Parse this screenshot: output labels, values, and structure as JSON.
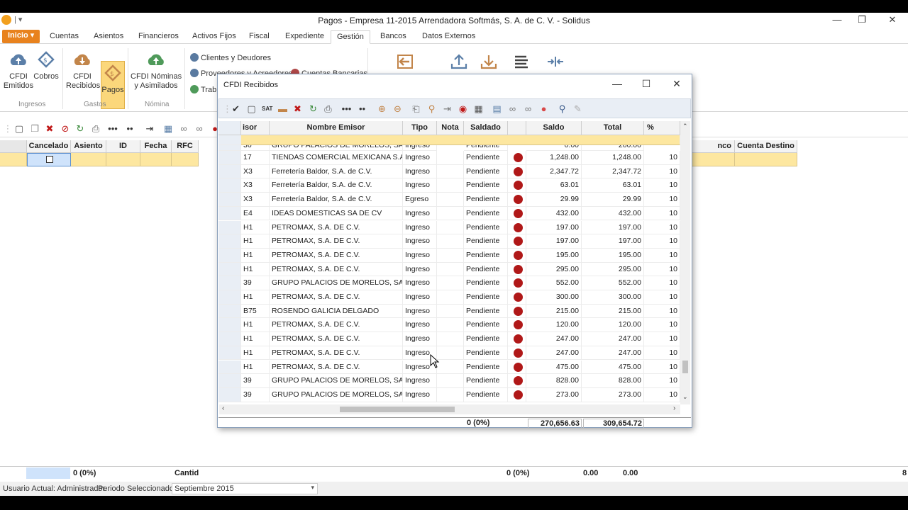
{
  "window": {
    "title": "Pagos - Empresa 11-2015 Arrendadora Softmás, S. A. de C. V. - Solidus",
    "quick_access": "| ▾",
    "minimize": "—",
    "restore": "❐",
    "close": "✕"
  },
  "tabs": [
    {
      "label": "Inicio ▾",
      "active": false,
      "file": true
    },
    {
      "label": "Cuentas",
      "active": false
    },
    {
      "label": "Asientos",
      "active": false
    },
    {
      "label": "Financieros",
      "active": false
    },
    {
      "label": "Activos Fijos",
      "active": false
    },
    {
      "label": "Fiscal",
      "active": false
    },
    {
      "label": "Expediente",
      "active": false
    },
    {
      "label": "Gestión",
      "active": true
    },
    {
      "label": "Bancos",
      "active": false
    },
    {
      "label": "Datos Externos",
      "active": false
    }
  ],
  "ribbon": {
    "cfdi_emitidos": "CFDI\nEmitidos",
    "cobros": "Cobros",
    "cfdi_recibidos": "CFDI\nRecibidos",
    "pagos": "Pagos",
    "cfdi_nominas": "CFDI Nóminas\ny Asimilados",
    "clientes_deudores": "Clientes y Deudores",
    "proveedores_acreedores": "Proveedores y Acreedores",
    "cuentas_bancarias": "Cuentas Bancarias",
    "trabajadores": "Trab",
    "group_ingresos": "Ingresos",
    "group_gastos": "Gastos",
    "group_nomina": "Nómina"
  },
  "main_grid": {
    "headers": [
      "Cancelado",
      "Asiento",
      "ID",
      "Fecha",
      "RFC"
    ],
    "right_headers": [
      "nco Destino",
      "Cuenta Destino"
    ]
  },
  "footer": {
    "count_left": "0 (0%)",
    "cantid": "Cantid",
    "count_mid": "0 (0%)",
    "total1": "0.00",
    "total2": "0.00",
    "edge": "8"
  },
  "statusbar": {
    "user": "Usuario Actual: Administrador",
    "period_label": "Periodo Seleccionado:",
    "period_value": "Septiembre 2015"
  },
  "dialog": {
    "title": "CFDI Recibidos",
    "minimize": "—",
    "maximize": "☐",
    "close": "✕",
    "headers": {
      "emisor": "isor",
      "nombre": "Nombre Emisor",
      "tipo": "Tipo",
      "nota": "Nota",
      "saldado": "Saldado",
      "dot": "",
      "saldo": "Saldo",
      "total": "Total",
      "deduc": "% Deduc"
    },
    "partial_row": {
      "emisor": "36",
      "nombre": "GRUPO PALACIOS DE MORELOS, SA DE",
      "tipo": "Ingreso",
      "saldado": "Pendiente",
      "saldo": "0.00",
      "total": "200.00",
      "deduc": ""
    },
    "rows": [
      {
        "emisor": "17",
        "nombre": "TIENDAS COMERCIAL MEXICANA S.A DE",
        "tipo": "Ingreso",
        "saldado": "Pendiente",
        "saldo": "1,248.00",
        "total": "1,248.00",
        "deduc": "10"
      },
      {
        "emisor": "X3",
        "nombre": "Ferretería Baldor, S.A. de C.V.",
        "tipo": "Ingreso",
        "saldado": "Pendiente",
        "saldo": "2,347.72",
        "total": "2,347.72",
        "deduc": "10"
      },
      {
        "emisor": "X3",
        "nombre": "Ferretería Baldor, S.A. de C.V.",
        "tipo": "Ingreso",
        "saldado": "Pendiente",
        "saldo": "63.01",
        "total": "63.01",
        "deduc": "10"
      },
      {
        "emisor": "X3",
        "nombre": "Ferretería Baldor, S.A. de C.V.",
        "tipo": "Egreso",
        "saldado": "Pendiente",
        "saldo": "29.99",
        "total": "29.99",
        "deduc": "10"
      },
      {
        "emisor": "E4",
        "nombre": "IDEAS DOMESTICAS SA DE CV",
        "tipo": "Ingreso",
        "saldado": "Pendiente",
        "saldo": "432.00",
        "total": "432.00",
        "deduc": "10"
      },
      {
        "emisor": "H1",
        "nombre": "PETROMAX, S.A. DE C.V.",
        "tipo": "Ingreso",
        "saldado": "Pendiente",
        "saldo": "197.00",
        "total": "197.00",
        "deduc": "10"
      },
      {
        "emisor": "H1",
        "nombre": "PETROMAX, S.A. DE C.V.",
        "tipo": "Ingreso",
        "saldado": "Pendiente",
        "saldo": "197.00",
        "total": "197.00",
        "deduc": "10"
      },
      {
        "emisor": "H1",
        "nombre": "PETROMAX, S.A. DE C.V.",
        "tipo": "Ingreso",
        "saldado": "Pendiente",
        "saldo": "195.00",
        "total": "195.00",
        "deduc": "10"
      },
      {
        "emisor": "H1",
        "nombre": "PETROMAX, S.A. DE C.V.",
        "tipo": "Ingreso",
        "saldado": "Pendiente",
        "saldo": "295.00",
        "total": "295.00",
        "deduc": "10"
      },
      {
        "emisor": "39",
        "nombre": "GRUPO PALACIOS DE MORELOS, SA DE",
        "tipo": "Ingreso",
        "saldado": "Pendiente",
        "saldo": "552.00",
        "total": "552.00",
        "deduc": "10"
      },
      {
        "emisor": "H1",
        "nombre": "PETROMAX, S.A. DE C.V.",
        "tipo": "Ingreso",
        "saldado": "Pendiente",
        "saldo": "300.00",
        "total": "300.00",
        "deduc": "10"
      },
      {
        "emisor": "B75",
        "nombre": "ROSENDO GALICIA DELGADO",
        "tipo": "Ingreso",
        "saldado": "Pendiente",
        "saldo": "215.00",
        "total": "215.00",
        "deduc": "10"
      },
      {
        "emisor": "H1",
        "nombre": "PETROMAX, S.A. DE C.V.",
        "tipo": "Ingreso",
        "saldado": "Pendiente",
        "saldo": "120.00",
        "total": "120.00",
        "deduc": "10"
      },
      {
        "emisor": "H1",
        "nombre": "PETROMAX, S.A. DE C.V.",
        "tipo": "Ingreso",
        "saldado": "Pendiente",
        "saldo": "247.00",
        "total": "247.00",
        "deduc": "10"
      },
      {
        "emisor": "H1",
        "nombre": "PETROMAX, S.A. DE C.V.",
        "tipo": "Ingreso",
        "saldado": "Pendiente",
        "saldo": "247.00",
        "total": "247.00",
        "deduc": "10"
      },
      {
        "emisor": "H1",
        "nombre": "PETROMAX, S.A. DE C.V.",
        "tipo": "Ingreso",
        "saldado": "Pendiente",
        "saldo": "475.00",
        "total": "475.00",
        "deduc": "10"
      },
      {
        "emisor": "39",
        "nombre": "GRUPO PALACIOS DE MORELOS, SA DE",
        "tipo": "Ingreso",
        "saldado": "Pendiente",
        "saldo": "828.00",
        "total": "828.00",
        "deduc": "10"
      },
      {
        "emisor": "39",
        "nombre": "GRUPO PALACIOS DE MORELOS, SA DE",
        "tipo": "Ingreso",
        "saldado": "Pendiente",
        "saldo": "273.00",
        "total": "273.00",
        "deduc": "10"
      }
    ],
    "footer": {
      "count": "0 (0%)",
      "saldo_total": "270,656.63",
      "total_total": "309,654.72"
    }
  },
  "colors": {
    "accent_orange": "#e8821e",
    "selected_ribbon": "#fbd77b",
    "highlight_row": "#fde7a0",
    "status_dot": "#b01818"
  }
}
